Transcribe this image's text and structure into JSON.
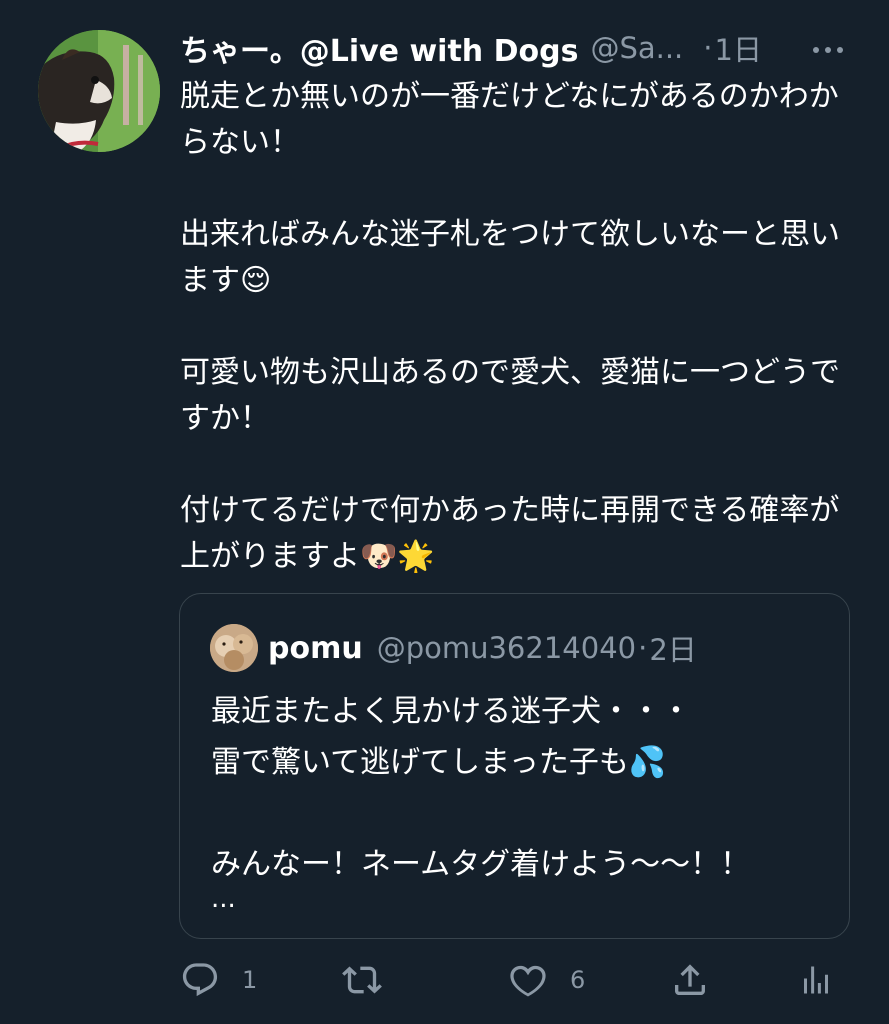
{
  "tweet": {
    "display_name": "ちゃー。@Live with Dogs",
    "handle": "@Sa...",
    "separator": "·",
    "time": "1日",
    "text": "脱走とか無いのが一番だけどなにがあるのかわからない！\n\n出来ればみんな迷子札をつけて欲しいなーと思います😌\n\n可愛い物も沢山あるので愛犬、愛猫に一つどうですか！\n\n付けてるだけで何かあった時に再開できる確率が上がりますよ🐶🌟"
  },
  "quote": {
    "display_name": "pomu",
    "handle": "@pomu36214040",
    "separator": "·",
    "time": "2日",
    "text": "最近またよく見かける迷子犬・・・\n雷で驚いて逃げてしまった子も💦\n\nみんなー！ネームタグ着けよう〜〜！！",
    "ellipsis": "..."
  },
  "actions": {
    "reply_count": "1",
    "like_count": "6"
  },
  "colors": {
    "background": "#15202b",
    "secondary_text": "#8b98a5",
    "border": "#38444d"
  }
}
